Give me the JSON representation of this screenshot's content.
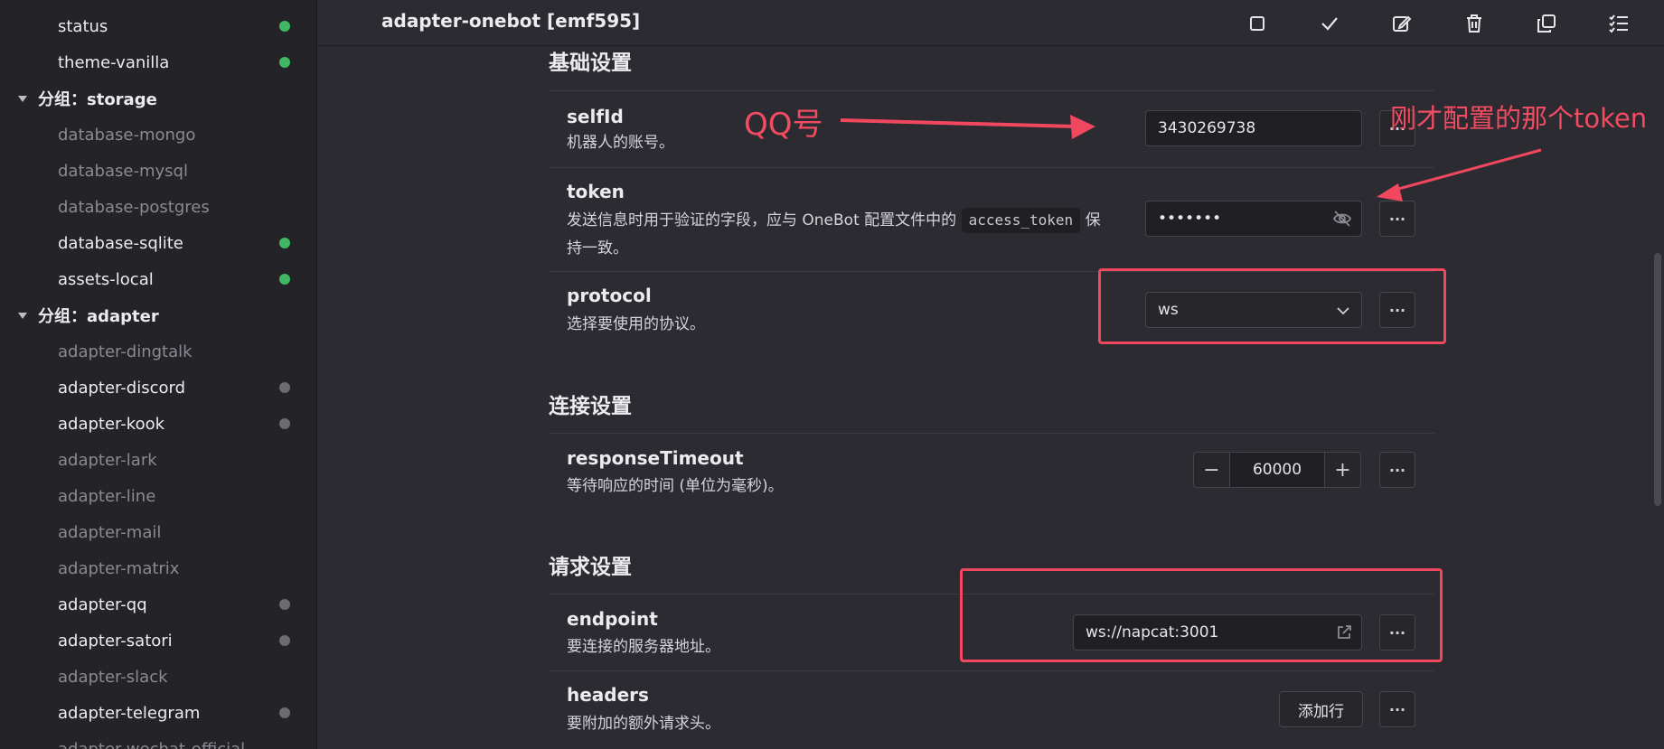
{
  "sidebar": {
    "items": [
      {
        "label": "status",
        "state": "active",
        "dot": "green"
      },
      {
        "label": "theme-vanilla",
        "state": "active",
        "dot": "green"
      },
      {
        "label": "分组：storage",
        "type": "group"
      },
      {
        "label": "database-mongo",
        "state": "inactive"
      },
      {
        "label": "database-mysql",
        "state": "inactive"
      },
      {
        "label": "database-postgres",
        "state": "inactive"
      },
      {
        "label": "database-sqlite",
        "state": "active",
        "dot": "green"
      },
      {
        "label": "assets-local",
        "state": "active",
        "dot": "green"
      },
      {
        "label": "分组：adapter",
        "type": "group"
      },
      {
        "label": "adapter-dingtalk",
        "state": "inactive"
      },
      {
        "label": "adapter-discord",
        "state": "active",
        "dot": "gray"
      },
      {
        "label": "adapter-kook",
        "state": "active",
        "dot": "gray"
      },
      {
        "label": "adapter-lark",
        "state": "inactive"
      },
      {
        "label": "adapter-line",
        "state": "inactive"
      },
      {
        "label": "adapter-mail",
        "state": "inactive"
      },
      {
        "label": "adapter-matrix",
        "state": "inactive"
      },
      {
        "label": "adapter-qq",
        "state": "active",
        "dot": "gray"
      },
      {
        "label": "adapter-satori",
        "state": "active",
        "dot": "gray"
      },
      {
        "label": "adapter-slack",
        "state": "inactive"
      },
      {
        "label": "adapter-telegram",
        "state": "active",
        "dot": "gray"
      },
      {
        "label": "adapter-wechat-official",
        "state": "inactive"
      }
    ]
  },
  "header": {
    "title": "adapter-onebot [emf595]",
    "icons": [
      "stop-icon",
      "check-icon",
      "edit-icon",
      "trash-icon",
      "copy-icon",
      "checklist-icon"
    ]
  },
  "sections": {
    "basic": {
      "title": "基础设置"
    },
    "connection": {
      "title": "连接设置"
    },
    "request": {
      "title": "请求设置"
    }
  },
  "fields": {
    "selfId": {
      "name": "selfId",
      "desc": "机器人的账号。",
      "value": "3430269738"
    },
    "token": {
      "name": "token",
      "desc_before": "发送信息时用于验证的字段，应与 OneBot 配置文件中的",
      "code": "access_token",
      "desc_after": "保",
      "desc_line2": "持一致。",
      "value": "•••••••"
    },
    "protocol": {
      "name": "protocol",
      "desc": "选择要使用的协议。",
      "value": "ws"
    },
    "responseTimeout": {
      "name": "responseTimeout",
      "desc": "等待响应的时间 (单位为毫秒)。",
      "value": "60000",
      "minus": "−",
      "plus": "+"
    },
    "endpoint": {
      "name": "endpoint",
      "desc": "要连接的服务器地址。",
      "value": "ws://napcat:3001"
    },
    "headers": {
      "name": "headers",
      "desc": "要附加的额外请求头。",
      "button": "添加行"
    }
  },
  "more_label": "···",
  "annotations": {
    "qq": "QQ号",
    "token": "刚才配置的那个token"
  },
  "colors": {
    "annotation": "#f2485f",
    "green_dot": "#3fb860",
    "gray_dot": "#6b6b72"
  }
}
